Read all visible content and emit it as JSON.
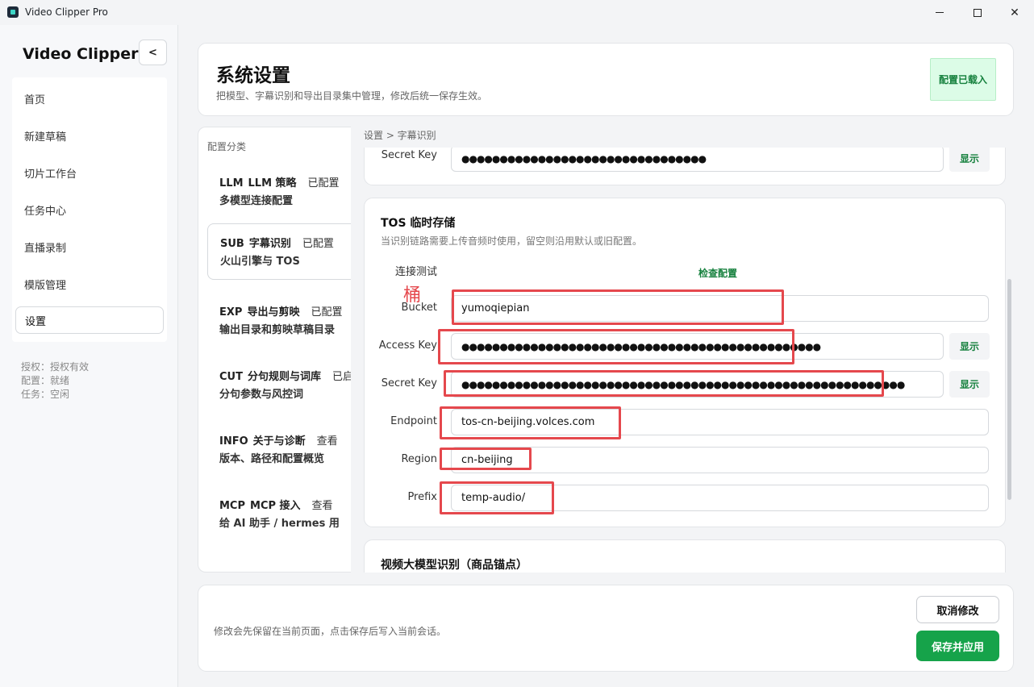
{
  "window": {
    "title": "Video Clipper Pro"
  },
  "sidebar": {
    "brand": "Video Clipper",
    "collapse_label": "<",
    "items": [
      {
        "label": "首页"
      },
      {
        "label": "新建草稿"
      },
      {
        "label": "切片工作台"
      },
      {
        "label": "任务中心"
      },
      {
        "label": "直播录制"
      },
      {
        "label": "模版管理"
      },
      {
        "label": "设置"
      }
    ],
    "status": {
      "license": "授权：授权有效",
      "config": "配置：就绪",
      "task": "任务：空闲"
    }
  },
  "header": {
    "title": "系统设置",
    "subtitle": "把模型、字幕识别和导出目录集中管理，修改后统一保存生效。",
    "badge": "配置已载入"
  },
  "categories": {
    "heading": "配置分类",
    "items": [
      {
        "code": "LLM",
        "name": "LLM 策略",
        "status": "已配置",
        "desc": "多模型连接配置"
      },
      {
        "code": "SUB",
        "name": "字幕识别",
        "status": "已配置",
        "desc": "火山引擎与 TOS"
      },
      {
        "code": "EXP",
        "name": "导出与剪映",
        "status": "已配置",
        "desc": "输出目录和剪映草稿目录"
      },
      {
        "code": "CUT",
        "name": "分句规则与词库",
        "status": "已启",
        "desc": "分句参数与风控词"
      },
      {
        "code": "INFO",
        "name": "关于与诊断",
        "status": "查看",
        "desc": "版本、路径和配置概览"
      },
      {
        "code": "MCP",
        "name": "MCP 接入",
        "status": "查看",
        "desc": "给 AI 助手 / hermes 用"
      }
    ]
  },
  "breadcrumb": "设置 > 字幕识别",
  "top_card": {
    "secret_key_label": "Secret Key",
    "secret_key_value": "●●●●●●●●●●●●●●●●●●●●●●●●●●●●●●●●",
    "show_label": "显示"
  },
  "tos": {
    "title": "TOS 临时存储",
    "desc": "当识别链路需要上传音频时使用，留空则沿用默认或旧配置。",
    "conn_test_label": "连接测试",
    "check_label": "检查配置",
    "bucket_label": "Bucket",
    "bucket_value": "yumoqiepian",
    "access_key_label": "Access Key",
    "access_key_value": "●●●●●●●●●●●●●●●●●●●●●●●●●●●●●●●●●●●●●●●●●●●●●●●",
    "secret_key_label": "Secret Key",
    "secret_key_value": "●●●●●●●●●●●●●●●●●●●●●●●●●●●●●●●●●●●●●●●●●●●●●●●●●●●●●●●●●●",
    "endpoint_label": "Endpoint",
    "endpoint_value": "tos-cn-beijing.volces.com",
    "region_label": "Region",
    "region_value": "cn-beijing",
    "prefix_label": "Prefix",
    "prefix_value": "temp-audio/",
    "show_label": "显示"
  },
  "next_card": {
    "title": "视频大模型识别（商品锚点）"
  },
  "annotation": {
    "text": "桶",
    "color": "#e5484d"
  },
  "footer": {
    "note": "修改会先保留在当前页面，点击保存后写入当前会话。",
    "cancel_label": "取消修改",
    "save_label": "保存并应用"
  },
  "colors": {
    "accent": "#16a34a",
    "accent_text": "#15803d",
    "badge_bg": "#dcfce7"
  }
}
